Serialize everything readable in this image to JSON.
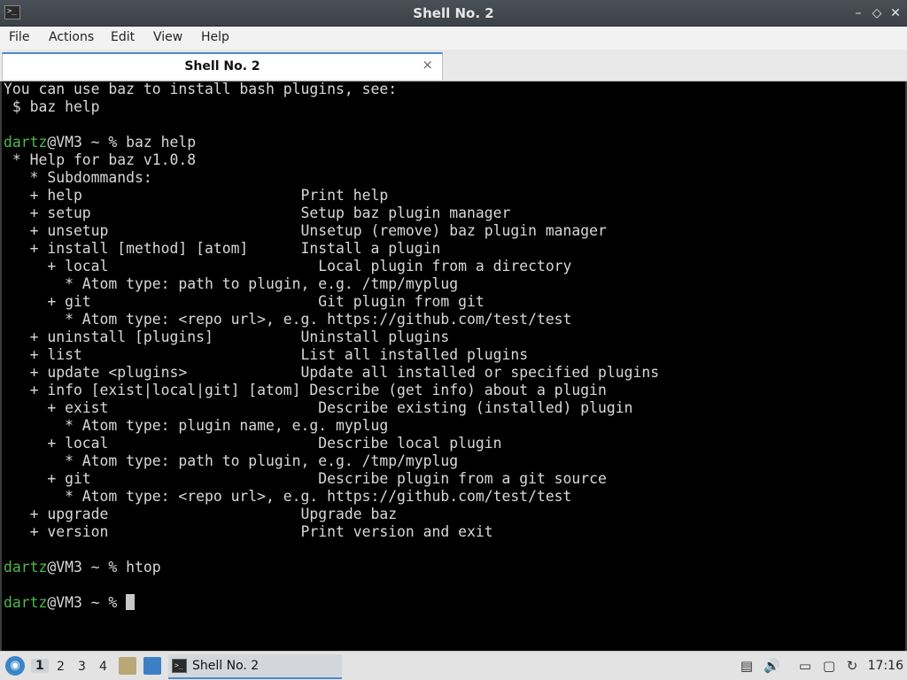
{
  "window": {
    "title": "Shell No. 2",
    "controls": {
      "minimize": "–",
      "restore": "◇",
      "close": "✕"
    }
  },
  "menu": [
    "File",
    "Actions",
    "Edit",
    "View",
    "Help"
  ],
  "tab": {
    "label": "Shell No. 2",
    "close": "×"
  },
  "terminal": {
    "lines": [
      {
        "text": "You can use baz to install bash plugins, see:"
      },
      {
        "text": " $ baz help"
      },
      {
        "text": ""
      },
      {
        "user": "dartz",
        "text": "@VM3 ~ % baz help"
      },
      {
        "text": " * Help for baz v1.0.8"
      },
      {
        "text": "   * Subdommands:"
      },
      {
        "text": "   + help                         Print help"
      },
      {
        "text": "   + setup                        Setup baz plugin manager"
      },
      {
        "text": "   + unsetup                      Unsetup (remove) baz plugin manager"
      },
      {
        "text": "   + install [method] [atom]      Install a plugin"
      },
      {
        "text": "     + local                        Local plugin from a directory"
      },
      {
        "text": "       * Atom type: path to plugin, e.g. /tmp/myplug"
      },
      {
        "text": "     + git                          Git plugin from git"
      },
      {
        "text": "       * Atom type: <repo url>, e.g. https://github.com/test/test"
      },
      {
        "text": "   + uninstall [plugins]          Uninstall plugins"
      },
      {
        "text": "   + list                         List all installed plugins"
      },
      {
        "text": "   + update <plugins>             Update all installed or specified plugins"
      },
      {
        "text": "   + info [exist|local|git] [atom] Describe (get info) about a plugin"
      },
      {
        "text": "     + exist                        Describe existing (installed) plugin"
      },
      {
        "text": "       * Atom type: plugin name, e.g. myplug"
      },
      {
        "text": "     + local                        Describe local plugin"
      },
      {
        "text": "       * Atom type: path to plugin, e.g. /tmp/myplug"
      },
      {
        "text": "     + git                          Describe plugin from a git source"
      },
      {
        "text": "       * Atom type: <repo url>, e.g. https://github.com/test/test"
      },
      {
        "text": "   + upgrade                      Upgrade baz"
      },
      {
        "text": "   + version                      Print version and exit"
      },
      {
        "text": ""
      },
      {
        "user": "dartz",
        "text": "@VM3 ~ % htop"
      },
      {
        "text": ""
      },
      {
        "user": "dartz",
        "text": "@VM3 ~ % ",
        "cursor": true
      }
    ]
  },
  "taskbar": {
    "workspaces": [
      "1",
      "2",
      "3",
      "4"
    ],
    "task_label": "Shell No. 2",
    "clock": "17:16"
  }
}
